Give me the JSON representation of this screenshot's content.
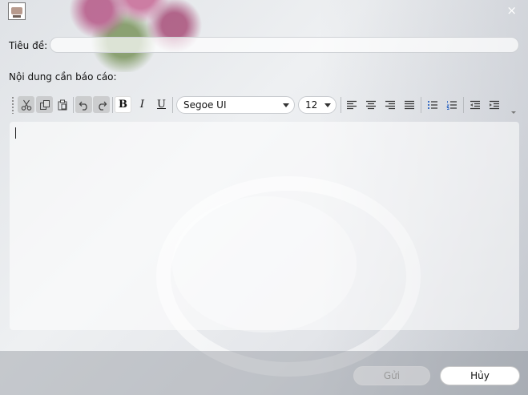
{
  "window": {
    "close_glyph": "×"
  },
  "form": {
    "title_label": "Tiêu đề:",
    "title_value": "",
    "content_label": "Nội dung cần báo cáo:",
    "content_value": ""
  },
  "toolbar": {
    "buttons": [
      {
        "name": "cut-icon",
        "enabled": false
      },
      {
        "name": "copy-icon",
        "enabled": false
      },
      {
        "name": "paste-icon",
        "enabled": false
      },
      {
        "name": "undo-icon",
        "enabled": false
      },
      {
        "name": "redo-icon",
        "enabled": false
      },
      {
        "name": "bold-icon",
        "label": "B",
        "enabled": true
      },
      {
        "name": "italic-icon",
        "label": "I",
        "enabled": true
      },
      {
        "name": "underline-icon",
        "label": "U",
        "enabled": true
      }
    ],
    "font_family": "Segoe UI",
    "font_size": "12",
    "align_buttons": [
      "align-left-icon",
      "align-center-icon",
      "align-right-icon",
      "align-justify-icon"
    ],
    "list_buttons": [
      "bullet-list-icon",
      "numbered-list-icon"
    ],
    "indent_buttons": [
      "decrease-indent-icon",
      "increase-indent-icon"
    ]
  },
  "actions": {
    "send_label": "Gửi",
    "send_enabled": false,
    "cancel_label": "Hủy"
  },
  "colors": {
    "disabled_button": "#b5b5b5",
    "text": "#111111"
  }
}
